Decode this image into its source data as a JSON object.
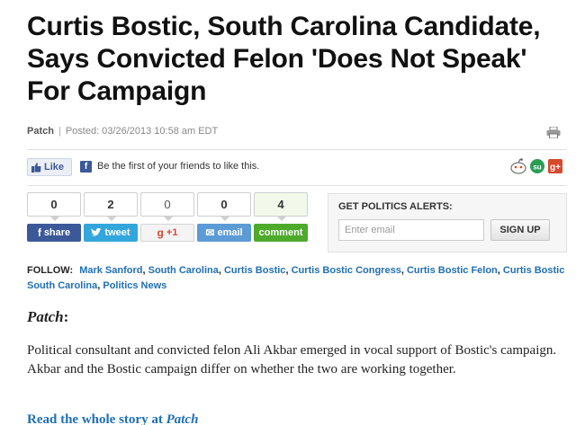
{
  "headline": "Curtis Bostic, South Carolina Candidate, Says Convicted Felon 'Does Not Speak' For Campaign",
  "byline": {
    "source": "Patch",
    "separator": "|",
    "posted": "Posted: 03/26/2013 10:58 am EDT"
  },
  "print_icon": "printer-icon",
  "facebook": {
    "like_label": "Like",
    "fb_letter": "f",
    "prompt": "Be the first of your friends to like this."
  },
  "social_icons": [
    "reddit-icon",
    "stumbleupon-icon",
    "google-plus-icon"
  ],
  "share_buttons": [
    {
      "count": "0",
      "label": "share",
      "glyph": "f",
      "icon": "facebook-icon",
      "color": "#3b5998"
    },
    {
      "count": "2",
      "label": "tweet",
      "glyph": "t",
      "icon": "twitter-icon",
      "color": "#33a6dc"
    },
    {
      "count": "0",
      "label": "+1",
      "glyph": "g",
      "icon": "google-plus-icon",
      "color": "#e0e0e0"
    },
    {
      "count": "0",
      "label": "email",
      "glyph": "✉",
      "icon": "email-icon",
      "color": "#5b9bd6"
    },
    {
      "count": "4",
      "label": "comment",
      "glyph": "",
      "icon": "comment-icon",
      "color": "#4eaa2b"
    }
  ],
  "alerts": {
    "title": "GET POLITICS ALERTS:",
    "email_placeholder": "Enter email",
    "signup_label": "SIGN UP"
  },
  "follow": {
    "label": "FOLLOW:",
    "tags": [
      "Mark Sanford",
      "South Carolina",
      "Curtis Bostic",
      "Curtis Bostic Congress",
      "Curtis Bostic Felon",
      "Curtis Bostic South Carolina",
      "Politics News"
    ]
  },
  "article": {
    "source_name": "Patch",
    "source_suffix": ":",
    "paragraph": "Political consultant and convicted felon Ali Akbar emerged in vocal support of Bostic's campaign. Akbar and the Bostic campaign differ on whether the two are working together.",
    "read_more_prefix": "Read the whole story at",
    "read_more_source": "Patch"
  },
  "colors": {
    "link": "#1f6fb4",
    "facebook": "#3b5998",
    "twitter": "#33a6dc",
    "comment": "#4eaa2b"
  }
}
